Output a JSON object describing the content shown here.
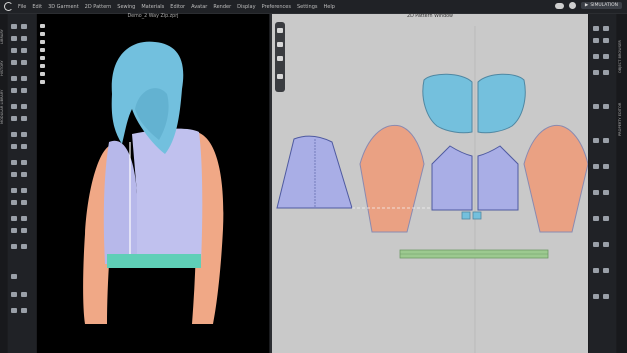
{
  "menubar": {
    "items": [
      "File",
      "Edit",
      "3D Garment",
      "2D Pattern",
      "Sewing",
      "Materials",
      "Editor",
      "Avatar",
      "Render",
      "Display",
      "Preferences",
      "Settings",
      "Help"
    ],
    "simulation_label": "SIMULATION"
  },
  "left_tabs": [
    "LIBRARY",
    "HISTORY",
    "MODULAR LIBRARY"
  ],
  "right_tabs": [
    "OBJECT BROWSER",
    "PROPERTY EDITOR"
  ],
  "viewport3d": {
    "title": "Demo_2 Way Zip.zprj"
  },
  "pattern_window": {
    "title": "2D Pattern Window"
  },
  "colors": {
    "hood": "#72c0de",
    "body": "#b7b8ea",
    "sleeve": "#f0a886",
    "rib": "#5fcfb7",
    "pattern_bg": "#c9c9c9",
    "piece_blue": "#a9aee6",
    "piece_orange": "#eaa183",
    "piece_hood": "#74c0dd",
    "piece_green": "#9cc98f"
  },
  "icons": [
    "logo-icon",
    "cloud-icon",
    "settings-icon",
    "simulation-icon"
  ]
}
